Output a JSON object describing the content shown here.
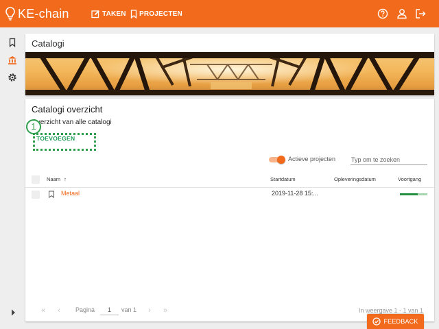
{
  "colors": {
    "brand": "#f26a1b",
    "accent_green": "#1f9d55",
    "link": "#f26a1b"
  },
  "header": {
    "app_name": "KE-chain",
    "nav": [
      {
        "label": "TAKEN",
        "icon": "edit-icon"
      },
      {
        "label": "PROJECTEN",
        "icon": "bookmark-icon"
      }
    ],
    "icons": [
      "help-icon",
      "user-icon",
      "logout-icon"
    ]
  },
  "sidebar": {
    "icons": [
      "bookmark-icon",
      "catalog-icon",
      "settings-icon",
      "expand-arrow-icon"
    ]
  },
  "banner": {
    "title": "Catalogi",
    "image": "bridge-photo"
  },
  "overview": {
    "title": "Catalogi overzicht",
    "subtitle": "Overzicht van alle catalogi",
    "add_label": "TOEVOEGEN",
    "toggle_label": "Actieve projecten",
    "toggle_on": true,
    "search_placeholder": "Typ om te zoeken"
  },
  "table": {
    "columns": {
      "name": "Naam",
      "sort_indicator": "↑",
      "start": "Startdatum",
      "delivery": "Opleveringsdatum",
      "progress": "Voortgang"
    },
    "rows": [
      {
        "name": "Metaal",
        "start": "2019-11-28 15:...",
        "delivery": "",
        "progress": 0.65
      }
    ]
  },
  "pagination": {
    "page_label": "Pagina",
    "page": "1",
    "of_label": "van 1",
    "summary": "In weergave 1 - 1 van 1"
  },
  "annotation": {
    "number": "1"
  },
  "feedback": {
    "label": "FEEDBACK"
  }
}
